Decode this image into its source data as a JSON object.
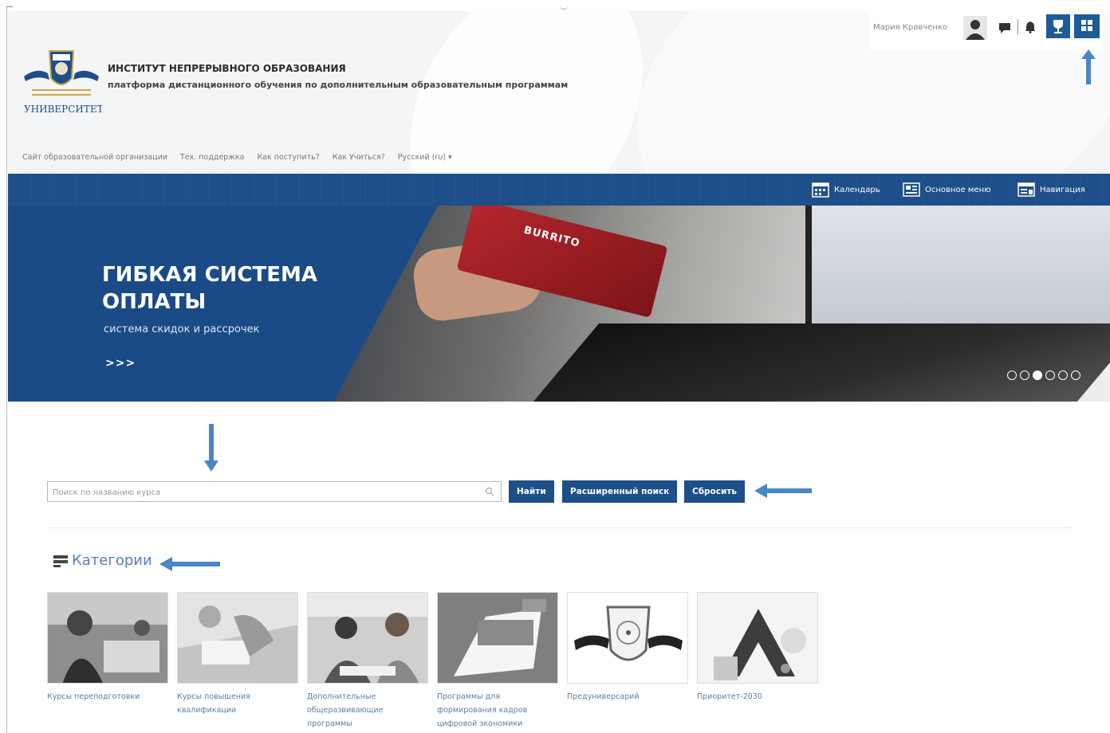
{
  "header": {
    "institute_title": "ИНСТИТУТ НЕПРЕРЫВНОГО ОБРАЗОВАНИЯ",
    "institute_subtitle": "платформа дистанционного обучения по дополнительным образовательным программам",
    "logo_caption": "УНИВЕРСИТЕТ",
    "user_name": "Мария Кравченко"
  },
  "top_nav": {
    "items": [
      "Сайт образовательной организации",
      "Тех. поддержка",
      "Как поступить?",
      "Как Учиться?",
      "Русский (ru) ▾"
    ]
  },
  "blue_bar": {
    "calendar": "Календарь",
    "main_menu": "Основное меню",
    "navigation": "Навигация"
  },
  "slider": {
    "title_line1": "ГИБКАЯ СИСТЕМА",
    "title_line2": "ОПЛАТЫ",
    "subtitle": "система скидок и рассрочек",
    "more": ">>>",
    "card_text": "BURRITO",
    "dots_total": 6,
    "active_index": 2
  },
  "search": {
    "placeholder": "Поиск по названию курса",
    "find": "Найти",
    "advanced": "Расширенный поиск",
    "reset": "Сбросить"
  },
  "categories": {
    "title": "Категории",
    "items": [
      {
        "label": "Курсы переподготовки"
      },
      {
        "label": "Курсы повышения квалификации"
      },
      {
        "label": "Дополнительные общеразвивающие программы"
      },
      {
        "label": "Программы для формирования кадров цифровой экономики"
      },
      {
        "label": "Предуниверсарий"
      },
      {
        "label": "Приоритет-2030"
      }
    ]
  },
  "colors": {
    "primary_blue": "#1e4f8a",
    "arrow_blue": "#4a86c5",
    "link_blue": "#5e7fa7"
  }
}
